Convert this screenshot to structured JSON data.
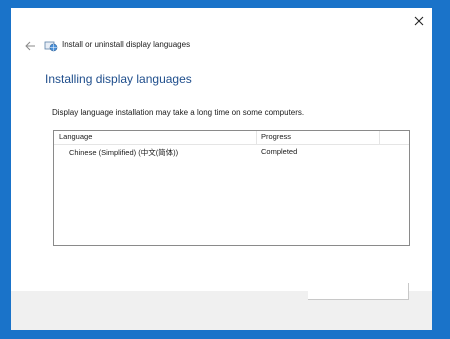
{
  "window": {
    "title": "Install or uninstall display languages"
  },
  "page": {
    "heading": "Installing display languages",
    "notice": "Display language installation may take a long time on some computers."
  },
  "list": {
    "columns": [
      "Language",
      "Progress"
    ],
    "rows": [
      {
        "language": "Chinese (Simplified) (中文(简体))",
        "progress": "Completed"
      }
    ]
  },
  "icons": {
    "close": "close-icon",
    "back": "back-arrow-icon",
    "app": "language-app-icon"
  },
  "colors": {
    "desktop": "#1a73c9",
    "heading": "#1f4e8c",
    "footer": "#f0f0f0"
  }
}
